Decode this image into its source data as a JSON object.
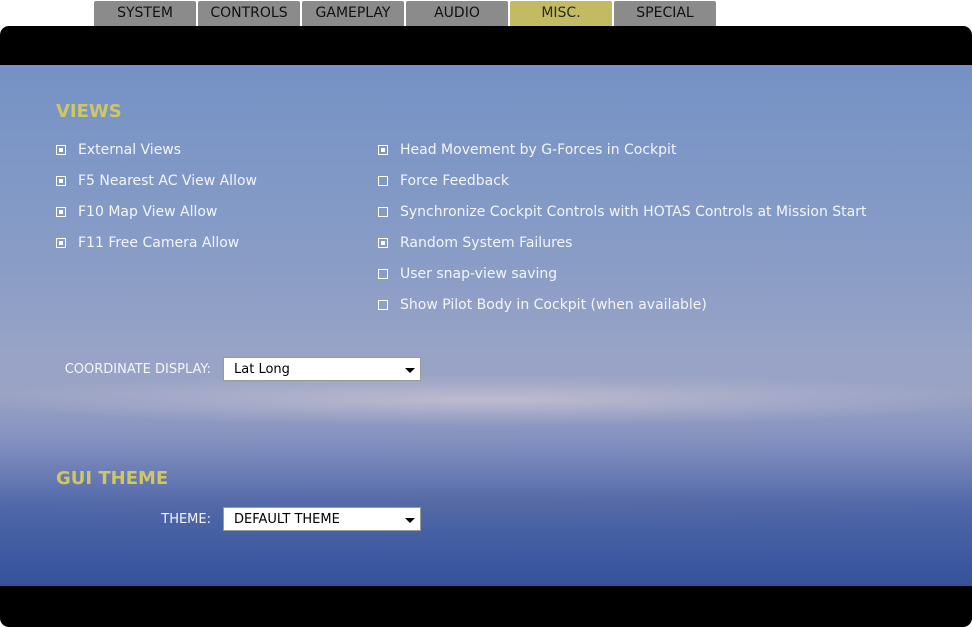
{
  "tabs": [
    {
      "label": "SYSTEM",
      "active": false
    },
    {
      "label": "CONTROLS",
      "active": false
    },
    {
      "label": "GAMEPLAY",
      "active": false
    },
    {
      "label": "AUDIO",
      "active": false
    },
    {
      "label": "MISC.",
      "active": true
    },
    {
      "label": "SPECIAL",
      "active": false
    }
  ],
  "views": {
    "title": "VIEWS",
    "left_options": [
      {
        "label": "External Views",
        "checked": true
      },
      {
        "label": "F5 Nearest AC View Allow",
        "checked": true
      },
      {
        "label": "F10 Map View Allow",
        "checked": true
      },
      {
        "label": "F11 Free Camera Allow",
        "checked": true
      }
    ],
    "right_options": [
      {
        "label": "Head Movement by G-Forces in Cockpit",
        "checked": true
      },
      {
        "label": "Force Feedback",
        "checked": false
      },
      {
        "label": "Synchronize Cockpit Controls with HOTAS Controls at Mission Start",
        "checked": false
      },
      {
        "label": "Random System Failures",
        "checked": true
      },
      {
        "label": "User snap-view saving",
        "checked": false
      },
      {
        "label": "Show Pilot Body in Cockpit (when available)",
        "checked": false
      }
    ],
    "coordinate_display": {
      "label": "COORDINATE DISPLAY:",
      "value": "Lat Long"
    }
  },
  "gui_theme": {
    "title": "GUI THEME",
    "theme": {
      "label": "THEME:",
      "value": "DEFAULT THEME"
    }
  },
  "colors": {
    "section_title": "#cfc764",
    "tab_active": "#c2bb62",
    "tab_inactive": "#8b8b8b"
  }
}
